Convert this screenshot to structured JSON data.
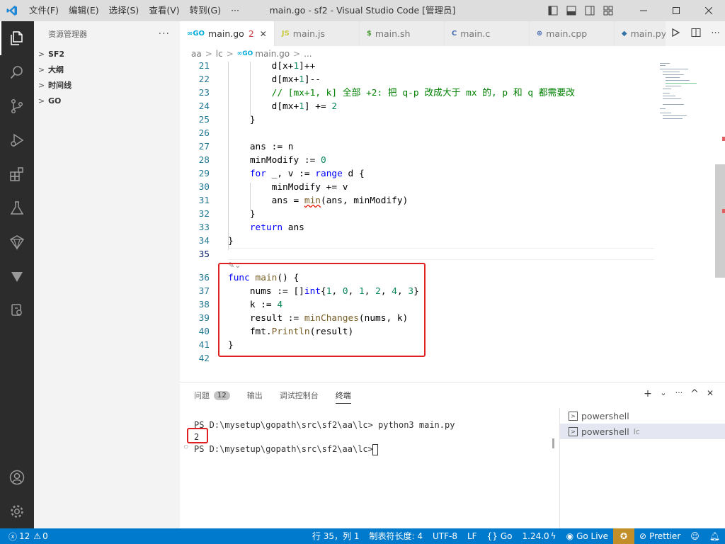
{
  "titlebar": {
    "menu": [
      "文件(F)",
      "编辑(E)",
      "选择(S)",
      "查看(V)",
      "转到(G)",
      "···"
    ],
    "title": "main.go - sf2 - Visual Studio Code [管理员]"
  },
  "sidebar": {
    "title": "资源管理器",
    "more": "···",
    "sections": [
      "SF2",
      "大纲",
      "时间线",
      "GO"
    ]
  },
  "tabs": [
    {
      "icon": "∞GO",
      "label": "main.go",
      "badge": "2",
      "close": "✕"
    },
    {
      "icon": "JS",
      "label": "main.js"
    },
    {
      "icon": "$",
      "label": "main.sh"
    },
    {
      "icon": "C",
      "label": "main.c"
    },
    {
      "icon": "⊕",
      "label": "main.cpp"
    },
    {
      "icon": "◆",
      "label": "main.py"
    }
  ],
  "breadcrumb": {
    "parts": [
      "aa",
      "lc",
      "main.go",
      "..."
    ],
    "icon": "∞GO",
    "sep": ">"
  },
  "editor": {
    "lines": [
      {
        "n": "21",
        "text": "        d[x+1]++"
      },
      {
        "n": "22",
        "text": "        d[mx+1]--"
      },
      {
        "n": "23",
        "text": "        // [mx+1, k] 全部 +2: 把 q-p 改成大于 mx 的, p 和 q 都需要改"
      },
      {
        "n": "24",
        "text": "        d[mx+1] += 2"
      },
      {
        "n": "25",
        "text": "    }"
      },
      {
        "n": "26",
        "text": ""
      },
      {
        "n": "27",
        "text": "    ans := n"
      },
      {
        "n": "28",
        "text": "    minModify := 0"
      },
      {
        "n": "29",
        "text": "    for _, v := range d {"
      },
      {
        "n": "30",
        "text": "        minModify += v"
      },
      {
        "n": "31",
        "text": "        ans = min(ans, minModify)"
      },
      {
        "n": "32",
        "text": "    }"
      },
      {
        "n": "33",
        "text": "    return ans"
      },
      {
        "n": "34",
        "text": "}"
      },
      {
        "n": "35",
        "text": ""
      },
      {
        "n": "36",
        "text": "func main() {"
      },
      {
        "n": "37",
        "text": "    nums := []int{1, 0, 1, 2, 4, 3}"
      },
      {
        "n": "38",
        "text": "    k := 4"
      },
      {
        "n": "39",
        "text": "    result := minChanges(nums, k)"
      },
      {
        "n": "40",
        "text": "    fmt.Println(result)"
      },
      {
        "n": "41",
        "text": "}"
      },
      {
        "n": "42",
        "text": ""
      }
    ]
  },
  "panel": {
    "tabs": [
      {
        "label": "问题",
        "badge": "12"
      },
      {
        "label": "输出"
      },
      {
        "label": "调试控制台"
      },
      {
        "label": "终端"
      }
    ],
    "actions": [
      "+",
      "⌄",
      "···",
      "^",
      "✕"
    ],
    "terminal": {
      "lines": [
        "PS D:\\mysetup\\gopath\\src\\sf2\\aa\\lc> python3 main.py",
        "2",
        "PS D:\\mysetup\\gopath\\src\\sf2\\aa\\lc> "
      ]
    },
    "terminal_list": [
      {
        "label": "powershell",
        "sub": ""
      },
      {
        "label": "powershell",
        "sub": "lc"
      }
    ]
  },
  "statusbar": {
    "errors": "12",
    "warnings": "0",
    "position": "行 35，列 1",
    "indent": "制表符长度: 4",
    "encoding": "UTF-8",
    "eol": "LF",
    "language": "Go",
    "go_version": "1.24.0",
    "golive": "Go Live",
    "prettier": "Prettier"
  },
  "colors": {
    "statusbar": "#007acc",
    "activitybar": "#2c2c2c",
    "highlight_box": "#e02020"
  }
}
